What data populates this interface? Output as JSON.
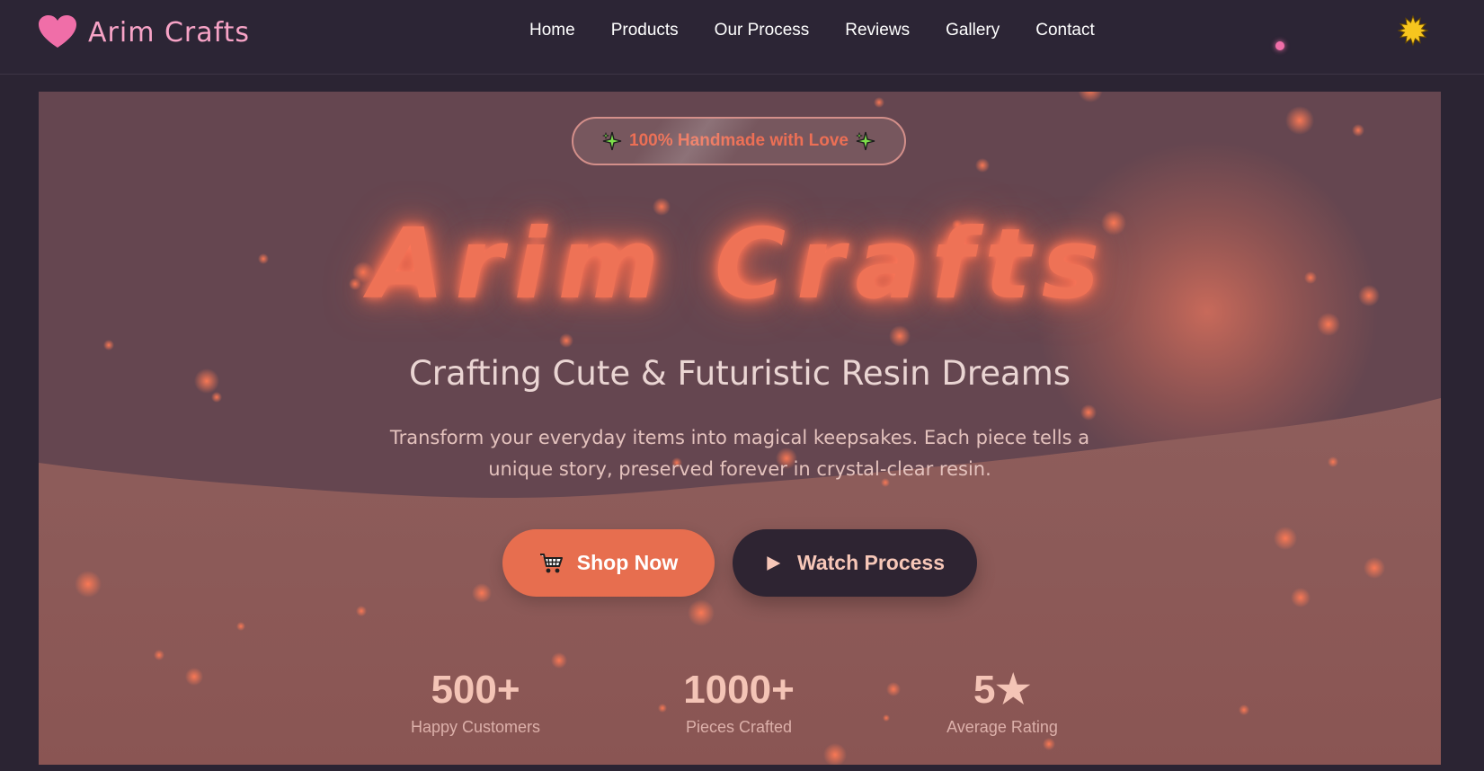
{
  "header": {
    "brand": {
      "name": "Arim Crafts",
      "icon": "heart-icon"
    },
    "nav_items": [
      {
        "label": "Home"
      },
      {
        "label": "Products"
      },
      {
        "label": "Our Process"
      },
      {
        "label": "Reviews"
      },
      {
        "label": "Gallery"
      },
      {
        "label": "Contact"
      }
    ],
    "theme_toggle_icon": "sun-icon"
  },
  "hero": {
    "badge": {
      "text": "100% Handmade with Love",
      "icon": "sparkle-icon"
    },
    "title": "Arim Crafts",
    "tagline": "Crafting Cute & Futuristic Resin Dreams",
    "description": "Transform your everyday items into magical keepsakes. Each piece tells a unique story, preserved forever in crystal-clear resin.",
    "buttons": {
      "shop": {
        "label": "Shop Now",
        "icon": "shopping-cart-icon"
      },
      "watch": {
        "label": "Watch Process",
        "icon": "play-icon"
      }
    },
    "stats": [
      {
        "value": "500+",
        "label": "Happy Customers"
      },
      {
        "value": "1000+",
        "label": "Pieces Crafted"
      },
      {
        "value": "5★",
        "label": "Average Rating"
      }
    ]
  },
  "colors": {
    "page_bg": "#2b2433",
    "brand_pink": "#f7a3c6",
    "accent_coral": "#e76e4f",
    "dark_button": "#2e2432",
    "stat_text": "#f4c4b6"
  }
}
